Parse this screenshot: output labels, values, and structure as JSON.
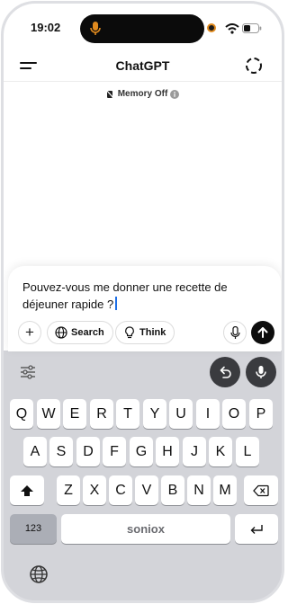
{
  "status_bar": {
    "time": "19:02"
  },
  "header": {
    "title": "ChatGPT"
  },
  "memory": {
    "label": "Memory Off"
  },
  "composer": {
    "text": "Pouvez-vous me donner une recette de déjeuner rapide ?",
    "search_label": "Search",
    "think_label": "Think"
  },
  "keyboard": {
    "row1": [
      "Q",
      "W",
      "E",
      "R",
      "T",
      "Y",
      "U",
      "I",
      "O",
      "P"
    ],
    "row2": [
      "A",
      "S",
      "D",
      "F",
      "G",
      "H",
      "J",
      "K",
      "L"
    ],
    "row3": [
      "Z",
      "X",
      "C",
      "V",
      "B",
      "N",
      "M"
    ],
    "numbers_label": "123",
    "space_label": "soniox"
  },
  "icons": {
    "menu": "menu-icon",
    "new_chat": "new-chat-icon",
    "send": "arrow-up-icon",
    "microphone": "microphone-icon",
    "globe": "globe-icon",
    "undo": "undo-icon"
  },
  "colors": {
    "accent": "#0d0d0d",
    "caret": "#1e6fe6",
    "dynamic_island_mic": "#e08a1e"
  }
}
